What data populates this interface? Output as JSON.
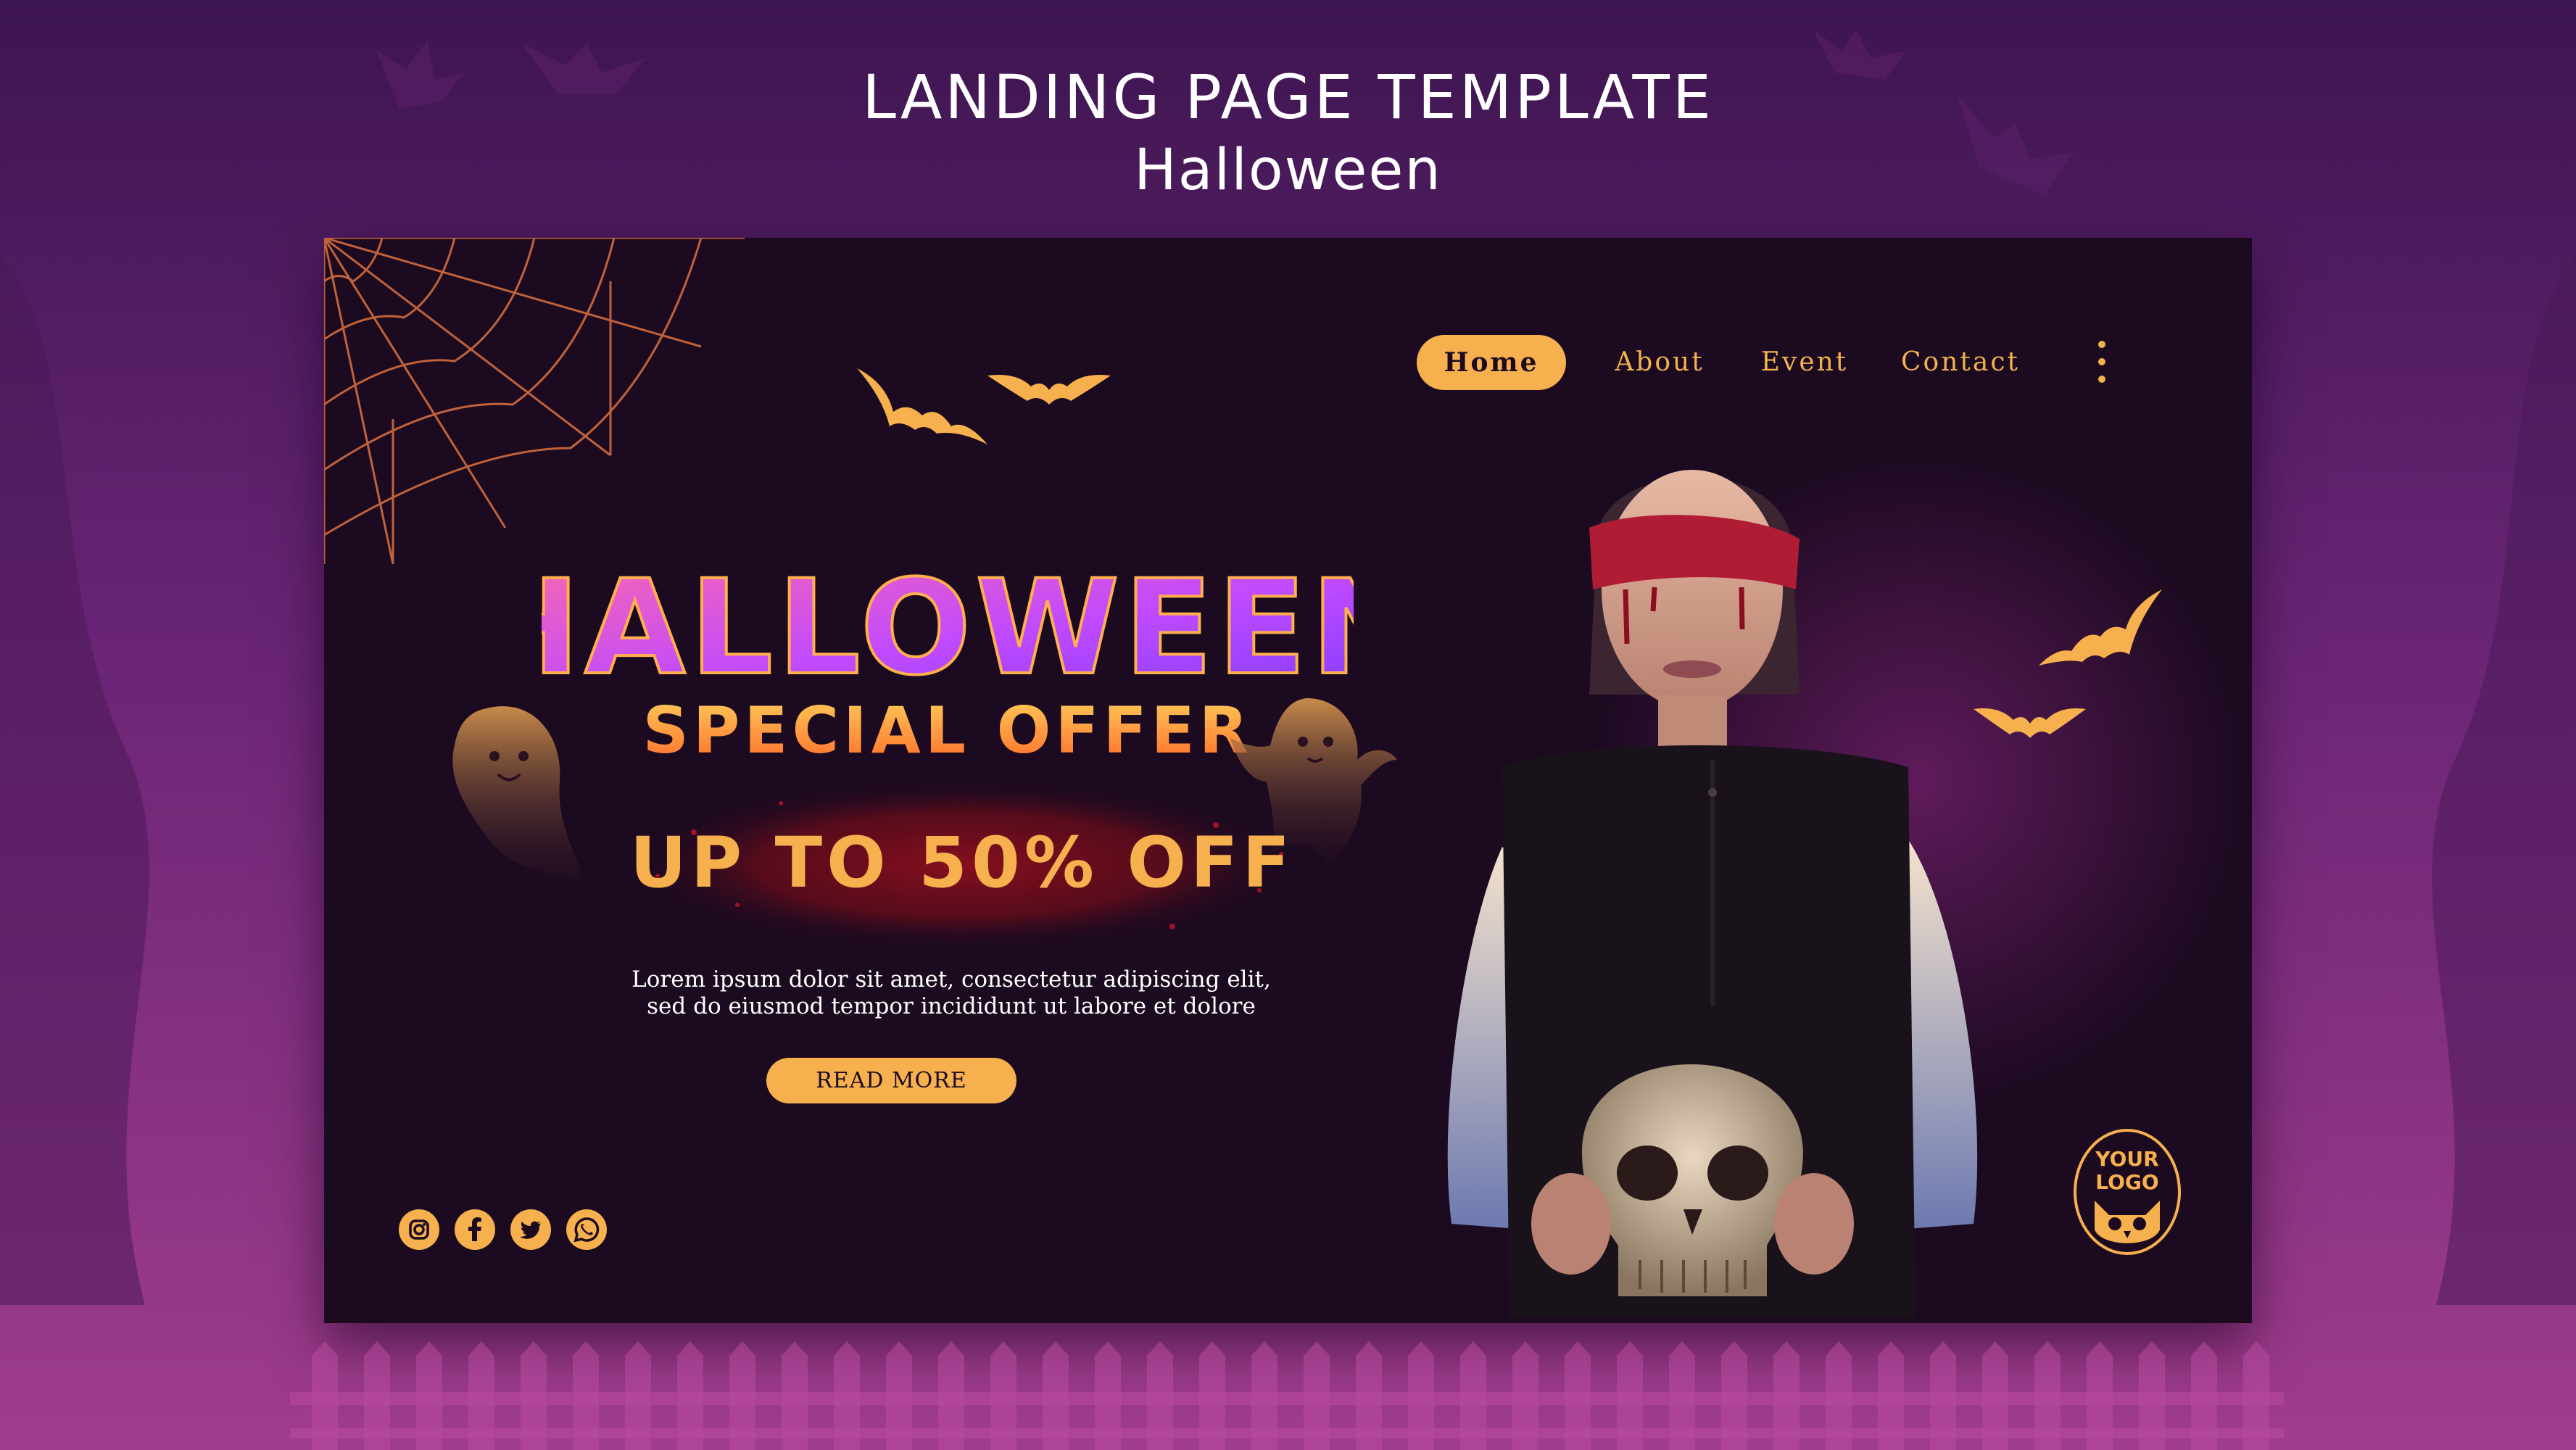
{
  "header": {
    "title": "LANDING PAGE TEMPLATE",
    "subtitle": "Halloween"
  },
  "nav": {
    "items": [
      {
        "label": "Home",
        "active": true
      },
      {
        "label": "About",
        "active": false
      },
      {
        "label": "Event",
        "active": false
      },
      {
        "label": "Contact",
        "active": false
      }
    ]
  },
  "hero": {
    "headline": "HALLOWEEN",
    "subheadline": "SPECIAL OFFER",
    "offer": "UP TO 50% OFF",
    "body_line1": "Lorem ipsum dolor sit amet, consectetur adipiscing elit,",
    "body_line2": "sed do eiusmod tempor incididunt ut labore et dolore",
    "cta_label": "READ MORE"
  },
  "social": {
    "icons": [
      "instagram-icon",
      "facebook-icon",
      "twitter-icon",
      "whatsapp-icon"
    ]
  },
  "logo": {
    "line1": "YOUR",
    "line2": "LOGO"
  },
  "colors": {
    "accent": "#f6b04d",
    "panel_bg": "#1c0a20",
    "headline_top": "#ff5fa0",
    "headline_bottom": "#8a3cff",
    "offer_text": "#f6b04d",
    "page_bg_top": "#3d1550",
    "page_bg_bottom": "#a03c8c"
  }
}
